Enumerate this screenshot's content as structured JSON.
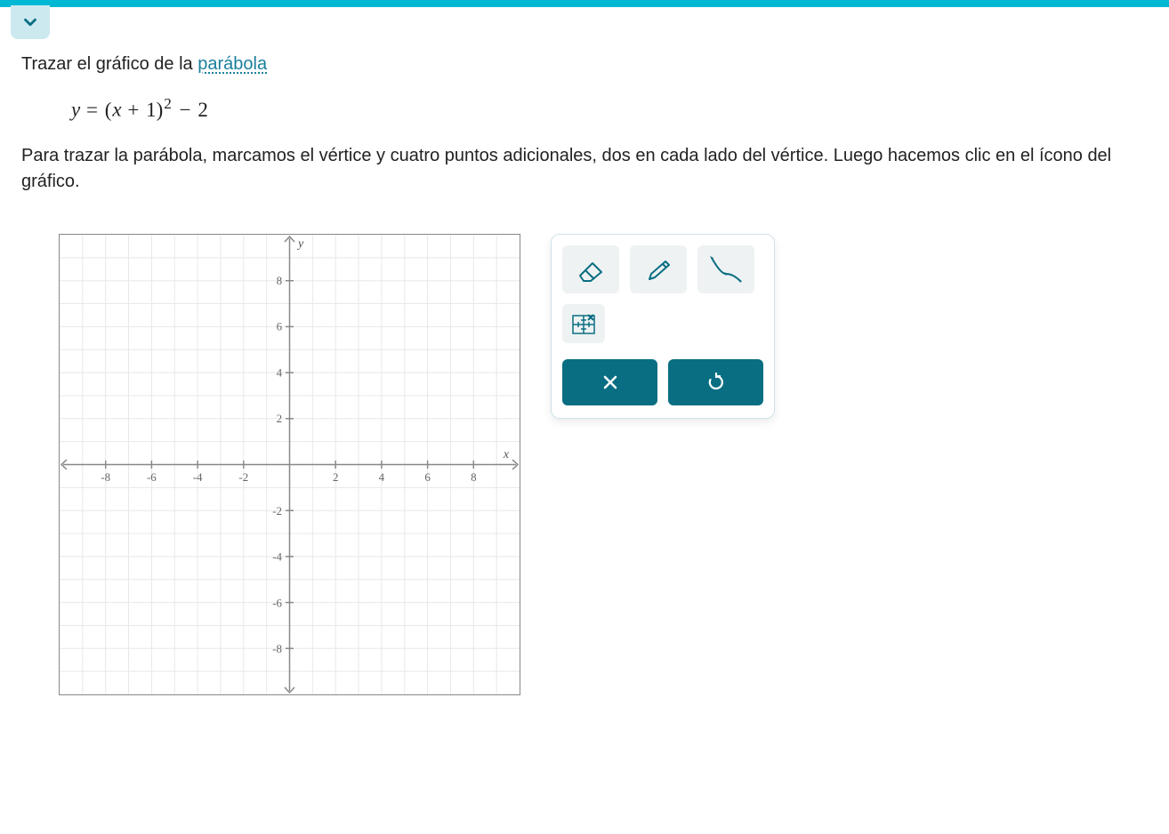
{
  "header": {
    "color": "#00b8d4"
  },
  "question": {
    "prefix": "Trazar el gráfico de la ",
    "link_text": "parábola"
  },
  "formula": {
    "text": "y = (x + 1)^2 − 2"
  },
  "instructions": "Para trazar la parábola, marcamos el vértice y cuatro puntos adicionales, dos en cada lado del vértice. Luego hacemos clic en el ícono del gráfico.",
  "chart_data": {
    "type": "scatter",
    "title": "",
    "xlabel": "x",
    "ylabel": "y",
    "xlim": [
      -10,
      10
    ],
    "ylim": [
      -10,
      10
    ],
    "x_ticks": [
      -8,
      -6,
      -4,
      -2,
      2,
      4,
      6,
      8
    ],
    "y_ticks": [
      -8,
      -6,
      -4,
      -2,
      2,
      4,
      6,
      8
    ],
    "series": []
  },
  "toolbox": {
    "tools": [
      {
        "name": "eraser-icon"
      },
      {
        "name": "pencil-icon"
      },
      {
        "name": "curve-icon"
      },
      {
        "name": "grid-zoom-icon"
      }
    ],
    "actions": [
      {
        "name": "close-icon"
      },
      {
        "name": "undo-icon"
      }
    ]
  }
}
